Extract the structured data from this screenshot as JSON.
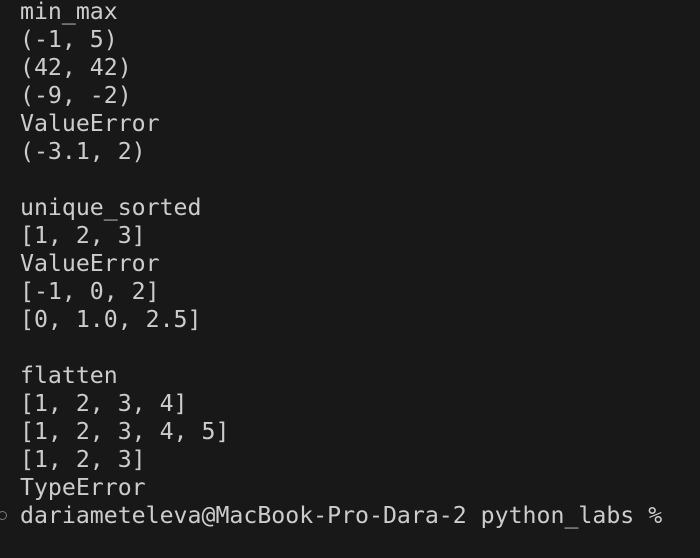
{
  "terminal": {
    "lines": [
      "min_max",
      "(-1, 5)",
      "(42, 42)",
      "(-9, -2)",
      "ValueError",
      "(-3.1, 2)",
      "",
      "unique_sorted",
      "[1, 2, 3]",
      "ValueError",
      "[-1, 0, 2]",
      "[0, 1.0, 2.5]",
      "",
      "flatten",
      "[1, 2, 3, 4]",
      "[1, 2, 3, 4, 5]",
      "[1, 2, 3]",
      "TypeError"
    ],
    "prompt": "dariameteleva@MacBook-Pro-Dara-2 python_labs %"
  }
}
